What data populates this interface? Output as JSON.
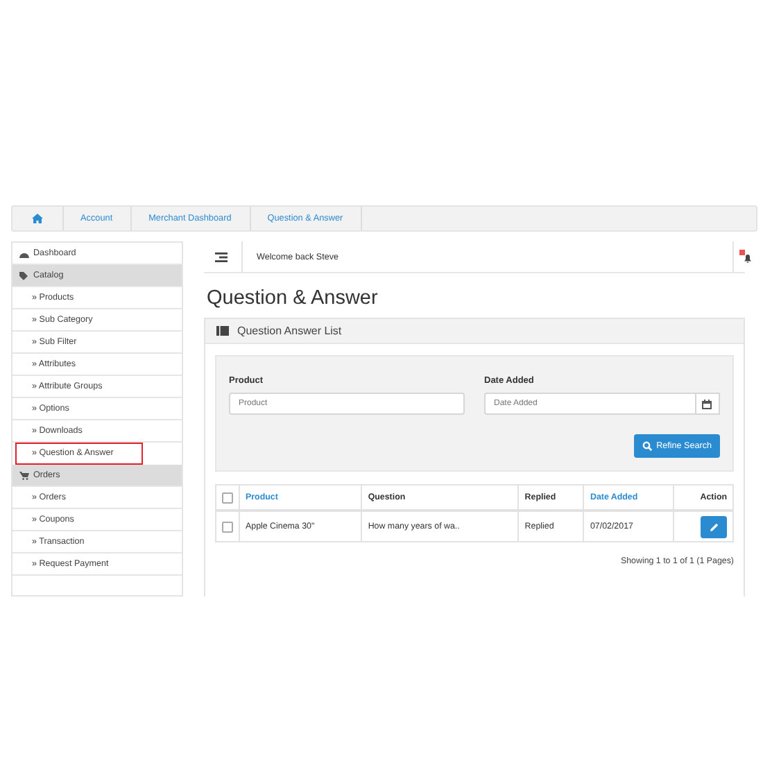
{
  "breadcrumb": [
    {
      "label": "Account"
    },
    {
      "label": "Merchant Dashboard"
    },
    {
      "label": "Question & Answer"
    }
  ],
  "sidebar": {
    "items": [
      {
        "label": "Dashboard",
        "expanded": false,
        "selected": false
      },
      {
        "label": "Catalog",
        "expanded": true,
        "selected": false,
        "children": [
          {
            "label": "» Products",
            "selected": false
          },
          {
            "label": "» Sub Category",
            "selected": false
          },
          {
            "label": "» Sub Filter",
            "selected": false
          },
          {
            "label": "» Attributes",
            "selected": false
          },
          {
            "label": "» Attribute Groups",
            "selected": false
          },
          {
            "label": "» Options",
            "selected": false
          },
          {
            "label": "» Downloads",
            "selected": false
          },
          {
            "label": "» Question & Answer",
            "selected": true
          }
        ]
      },
      {
        "label": "Orders",
        "expanded": true,
        "selected": false,
        "children": [
          {
            "label": "» Orders",
            "selected": false
          },
          {
            "label": "» Coupons",
            "selected": false
          },
          {
            "label": "» Transaction",
            "selected": false
          },
          {
            "label": "» Request Payment",
            "selected": false
          }
        ]
      }
    ]
  },
  "topbar": {
    "welcome": "Welcome back Steve"
  },
  "page_title": "Question & Answer",
  "panel": {
    "title": "Question Answer List",
    "filters": [
      {
        "label": "Product",
        "placeholder": "Product",
        "kind": "text"
      },
      {
        "label": "Date Added",
        "placeholder": "Date Added",
        "kind": "date"
      }
    ],
    "search_button": "Refine Search",
    "table": {
      "columns": [
        {
          "label": "Product",
          "sortable": true
        },
        {
          "label": "Question",
          "sortable": false
        },
        {
          "label": "Replied",
          "sortable": false
        },
        {
          "label": "Date Added",
          "sortable": true
        },
        {
          "label": "Action",
          "sortable": false
        }
      ],
      "header_checked": false,
      "rows": [
        {
          "checked": false,
          "cells": [
            "Apple Cinema 30\"",
            "How many years of wa..",
            "Replied",
            "07/02/2017"
          ]
        }
      ]
    },
    "pagination": "Showing 1 to 1 of 1 (1 Pages)"
  }
}
